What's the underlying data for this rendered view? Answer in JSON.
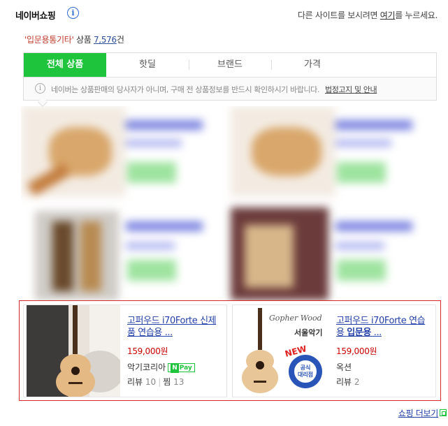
{
  "header": {
    "logo": "네이버쇼핑",
    "info_icon": "i",
    "notice_prefix": "다른 사이트를 보시려면 ",
    "notice_link": "여기",
    "notice_suffix": "를 누르세요."
  },
  "count": {
    "query": "'입문용통기타'",
    "label": " 상품 ",
    "num": "7,576",
    "suffix": "건"
  },
  "tabs": [
    "전체 상품",
    "핫딜",
    "브랜드",
    "가격"
  ],
  "disclaimer": {
    "text": "네이버는 상품판매의 당사자가 아니며, 구매 전 상품정보를 반드시 확인하시기 바랍니다.",
    "link": "법정고지 및 안내"
  },
  "products": [
    {
      "name_plain": "고퍼우드 i70Forte 신제품 연습용 ...",
      "price": "159,000원",
      "mall": "악기코리아",
      "npay": "Pay",
      "review_label": "리뷰",
      "review_count": "10",
      "zzim_label": "찜",
      "zzim_count": "13"
    },
    {
      "name_plain": "고퍼우드 i70Forte 연습용 ",
      "name_bold": "입문용",
      "name_tail": " ...",
      "price": "159,000원",
      "mall": "옥션",
      "review_label": "리뷰",
      "review_count": "2"
    }
  ],
  "thumb2": {
    "brand": "Gopher Wood",
    "store": "서울악기",
    "badge_new": "NEW",
    "badge_line1": "공식",
    "badge_line2": "대리점"
  },
  "more": "쇼핑 더보기",
  "colors": {
    "accent": "#1ec43c",
    "highlight_border": "#d9272e",
    "price": "#cc0000",
    "link": "#2340a8"
  }
}
